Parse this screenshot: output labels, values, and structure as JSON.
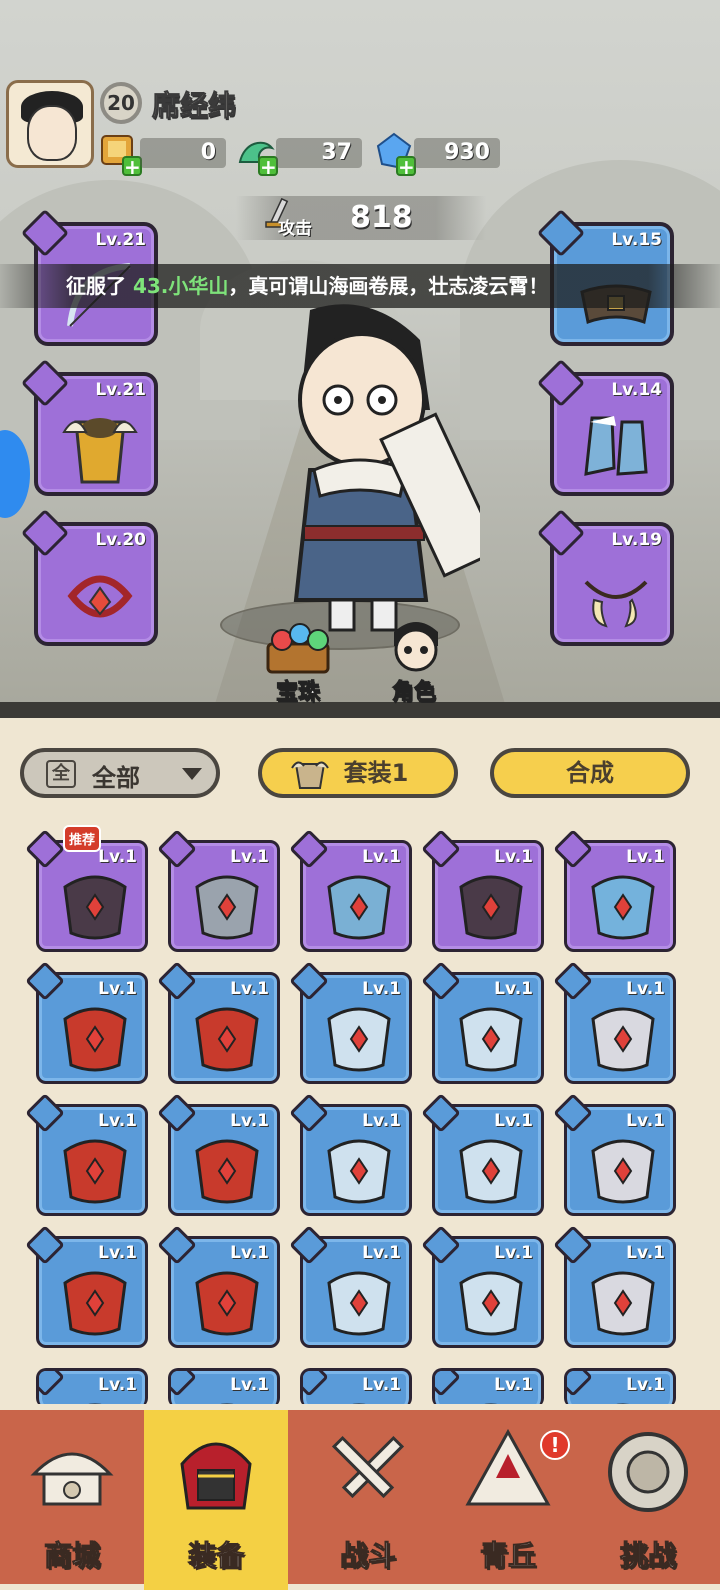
{
  "player": {
    "level": "20",
    "name": "席经纬"
  },
  "resources": [
    {
      "icon": "scroll-coin-icon",
      "value": "0"
    },
    {
      "icon": "jade-dragon-icon",
      "value": "37"
    },
    {
      "icon": "blue-crystal-icon",
      "value": "930"
    }
  ],
  "attack": {
    "label": "攻击",
    "value": "818"
  },
  "banner": {
    "prefix": "征服了",
    "highlight": "43.小华山",
    "suffix": "，真可谓山海画卷展，壮志凌云霄！"
  },
  "equipped": {
    "left": [
      {
        "level": "Lv.21",
        "slot_icon": "sword-slot-icon",
        "art": "bow-icon"
      },
      {
        "level": "Lv.21",
        "slot_icon": "armor-slot-icon",
        "art": "golden-armor-icon"
      },
      {
        "level": "Lv.20",
        "slot_icon": "ring-slot-icon",
        "art": "red-bracelet-icon"
      }
    ],
    "right": [
      {
        "level": "Lv.15",
        "slot_icon": "belt-slot-icon",
        "art": "belt-icon"
      },
      {
        "level": "Lv.14",
        "slot_icon": "boot-slot-icon",
        "art": "ice-boots-icon"
      },
      {
        "level": "Lv.19",
        "slot_icon": "necklace-slot-icon",
        "art": "fang-necklace-icon"
      }
    ]
  },
  "actions": {
    "orb": "宝珠",
    "character": "角色"
  },
  "filter": {
    "box": "全",
    "label": "全部"
  },
  "buttons": {
    "set": "套装1",
    "combine": "合成"
  },
  "inventory": {
    "recommend_badge": "推荐",
    "rows": [
      [
        {
          "level": "Lv.1",
          "rarity": "purple",
          "art": "dark-belt-icon"
        },
        {
          "level": "Lv.1",
          "rarity": "purple",
          "art": "hammer-icon"
        },
        {
          "level": "Lv.1",
          "rarity": "purple",
          "art": "frost-armor-icon"
        },
        {
          "level": "Lv.1",
          "rarity": "purple",
          "art": "dark-armor-icon"
        },
        {
          "level": "Lv.1",
          "rarity": "purple",
          "art": "ice-bracelet-icon"
        }
      ],
      [
        {
          "level": "Lv.1",
          "rarity": "blue",
          "art": "flower-slingshot-icon"
        },
        {
          "level": "Lv.1",
          "rarity": "blue",
          "art": "flower-slingshot-icon"
        },
        {
          "level": "Lv.1",
          "rarity": "blue",
          "art": "crossbow-icon"
        },
        {
          "level": "Lv.1",
          "rarity": "blue",
          "art": "crossbow-icon"
        },
        {
          "level": "Lv.1",
          "rarity": "blue",
          "art": "hammer-icon"
        }
      ],
      [
        {
          "level": "Lv.1",
          "rarity": "blue",
          "art": "dark-armor-icon"
        },
        {
          "level": "Lv.1",
          "rarity": "blue",
          "art": "red-bracelet-icon"
        },
        {
          "level": "Lv.1",
          "rarity": "blue",
          "art": "red-bracelet-icon"
        },
        {
          "level": "Lv.1",
          "rarity": "blue",
          "art": "dark-bracelet-icon"
        },
        {
          "level": "Lv.1",
          "rarity": "blue",
          "art": "dark-bracelet-icon"
        }
      ],
      [
        {
          "level": "Lv.1",
          "rarity": "blue",
          "art": "fang-necklace-icon"
        },
        {
          "level": "Lv.1",
          "rarity": "blue",
          "art": "fang-necklace-icon"
        },
        {
          "level": "Lv.1",
          "rarity": "blue",
          "art": "lotus-belt-icon"
        },
        {
          "level": "Lv.1",
          "rarity": "blue",
          "art": "lotus-belt-icon"
        },
        {
          "level": "Lv.1",
          "rarity": "blue",
          "art": "frost-belt-icon"
        }
      ],
      [
        {
          "level": "Lv.1",
          "rarity": "blue",
          "art": "belt-icon"
        },
        {
          "level": "Lv.1",
          "rarity": "blue",
          "art": "boots-icon"
        },
        {
          "level": "Lv.1",
          "rarity": "blue",
          "art": "belt-icon"
        },
        {
          "level": "Lv.1",
          "rarity": "blue",
          "art": "necklace-icon"
        },
        {
          "level": "Lv.1",
          "rarity": "blue",
          "art": "helmet-icon"
        }
      ]
    ]
  },
  "nav": [
    {
      "label": "商城",
      "icon": "shop-icon",
      "active": false
    },
    {
      "label": "装备",
      "icon": "equipment-helmet-icon",
      "active": true
    },
    {
      "label": "战斗",
      "icon": "crossed-swords-icon",
      "active": false
    },
    {
      "label": "青丘",
      "icon": "mountain-icon",
      "active": false,
      "alert": "!"
    },
    {
      "label": "挑战",
      "icon": "challenge-medallion-icon",
      "active": false
    }
  ],
  "colors": {
    "purple": "#9e70d8",
    "blue": "#5a9bd9",
    "nav_bg": "#c9654a",
    "nav_active": "#f4d044",
    "accent_yellow": "#f6cf4d",
    "highlight_green": "#7ee37a"
  }
}
